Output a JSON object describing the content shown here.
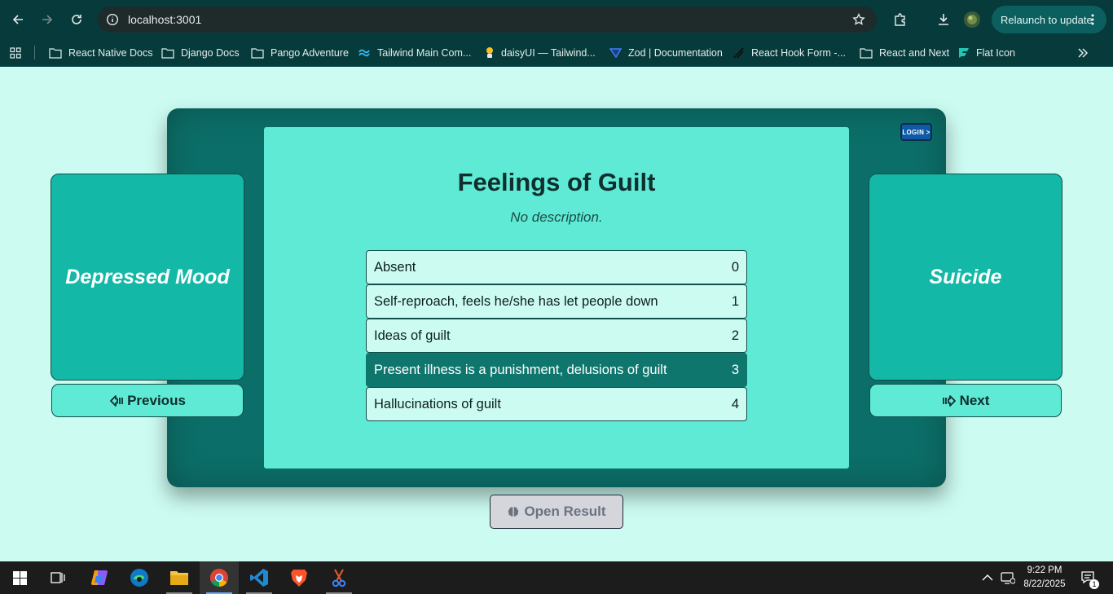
{
  "browser": {
    "url": "localhost:3001",
    "relaunch_label": "Relaunch to update",
    "bookmarks": [
      {
        "label": "React Native Docs",
        "icon": "folder-icon"
      },
      {
        "label": "Django Docs",
        "icon": "folder-icon"
      },
      {
        "label": "Pango Adventure",
        "icon": "folder-icon"
      },
      {
        "label": "Tailwind Main Com...",
        "icon": "tailwind-icon"
      },
      {
        "label": "daisyUI — Tailwind...",
        "icon": "daisyui-icon"
      },
      {
        "label": "Zod | Documentation",
        "icon": "zod-icon"
      },
      {
        "label": "React Hook Form -...",
        "icon": "react-hook-form-icon"
      },
      {
        "label": "React and Next",
        "icon": "folder-icon"
      },
      {
        "label": "Flat Icon",
        "icon": "flaticon-icon"
      }
    ]
  },
  "app": {
    "login_label": "LOGIN >",
    "title": "Feelings of Guilt",
    "description": "No description.",
    "options": [
      {
        "label": "Absent",
        "score": "0"
      },
      {
        "label": "Self-reproach, feels he/she has let people down",
        "score": "1"
      },
      {
        "label": "Ideas of guilt",
        "score": "2"
      },
      {
        "label": "Present illness is a punishment, delusions of guilt",
        "score": "3"
      },
      {
        "label": "Hallucinations of guilt",
        "score": "4"
      }
    ],
    "selected_index": 3,
    "previous_item": "Depressed Mood",
    "next_item": "Suicide",
    "previous_label": "Previous",
    "next_label": "Next",
    "result_label": "Open Result"
  },
  "taskbar": {
    "time": "9:22 PM",
    "date": "8/22/2025",
    "notification_count": "1"
  },
  "colors": {
    "background": "#ccfbf1",
    "frame": "#0c6e68",
    "card": "#5eead4",
    "side_card": "#14b8a6",
    "selected": "#0f766e"
  }
}
